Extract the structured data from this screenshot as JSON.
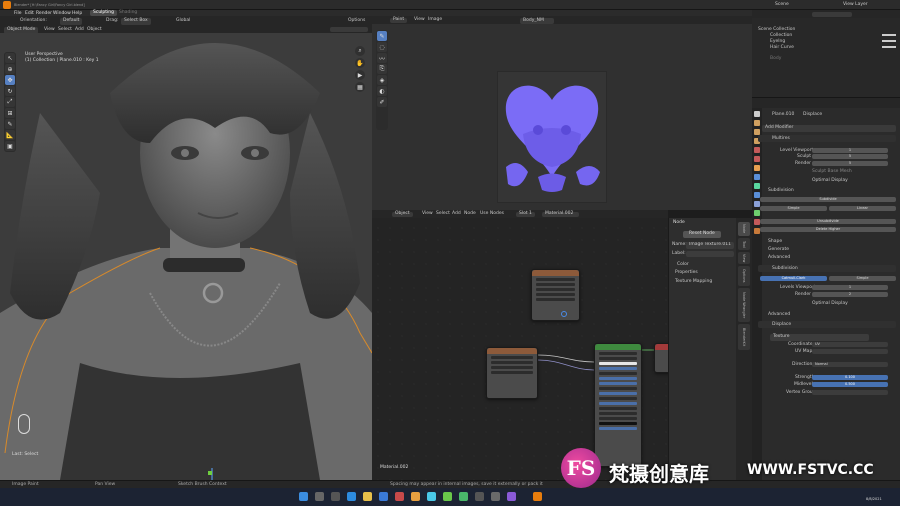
{
  "window": {
    "title": "Blender* [H:\\Fancy Girl\\Fancy Girl.blend]"
  },
  "menu": [
    "File",
    "Edit",
    "Render",
    "Window",
    "Help"
  ],
  "workspaces": [
    "Layout",
    "Modeling",
    "Sculpting",
    "UV Editing",
    "Texture Paint",
    "Shading"
  ],
  "active_workspace": "Sculpting",
  "top_right": {
    "scene": "Scene",
    "view_layer": "View Layer"
  },
  "viewport": {
    "orientation_label": "Orientation:",
    "orientation_value": "Default",
    "drag_label": "Drag:",
    "drag_value": "Select Box",
    "global_label": "Global",
    "options_label": "Options",
    "mode": "Object Mode",
    "menu": [
      "View",
      "Select",
      "Add",
      "Object"
    ],
    "overlay_title": "User Perspective",
    "overlay_sub": "(1) Collection | Plane.010 : Key 1",
    "status_left": "Last: Select"
  },
  "image_editor": {
    "menu": [
      "View",
      "Image"
    ],
    "mode": "Paint",
    "image_name": "Body_NM"
  },
  "node_editor": {
    "object_mode": "Object",
    "menu": [
      "View",
      "Select",
      "Add",
      "Node"
    ],
    "use_nodes": "Use Nodes",
    "slot": "Slot 1",
    "material": "Material.002",
    "footer_label": "Material.002",
    "tab_label": "Node",
    "reset_label": "Reset Node",
    "name_label": "Name:",
    "name_value": "Image Texture.011",
    "label_label": "Label:",
    "color_label": "Color",
    "properties_label": "Properties",
    "texture_mapping_label": "Texture Mapping",
    "side_tabs": [
      "Node",
      "Tool",
      "View",
      "Options",
      "Node Wrangler",
      "BlenderKit"
    ]
  },
  "outliner": {
    "title": "Scene Collection",
    "items": [
      "Collection",
      "Eyelng",
      "Hair Curve",
      "Body"
    ]
  },
  "properties": {
    "object_name": "Plane.010",
    "modifier_label": "Displace",
    "add_modifier": "Add Modifier",
    "multires": {
      "name": "Multires",
      "level_viewport_label": "Level Viewport",
      "level_viewport": "1",
      "sculpt_label": "Sculpt",
      "sculpt": "5",
      "render_label": "Render",
      "render": "5",
      "sculpt_base_mesh": "Sculpt Base Mesh",
      "optimal_display": "Optimal Display",
      "subdivision_label": "Subdivision",
      "subdivide": "Subdivide",
      "simple": "Simple",
      "linear": "Linear",
      "unsubdivide": "Unsubdivide",
      "delete_higher": "Delete Higher",
      "shape_label": "Shape",
      "generate_label": "Generate",
      "advanced_label": "Advanced"
    },
    "subdivision": {
      "name": "Subdivision",
      "catmull": "Catmull-Clark",
      "simple": "Simple",
      "levels_viewport_label": "Levels Viewport",
      "levels_viewport": "1",
      "render_label": "Render",
      "render": "2",
      "optimal_display": "Optimal Display",
      "advanced_label": "Advanced"
    },
    "displace": {
      "name": "Displace",
      "texture_label": "Texture",
      "coordinates_label": "Coordinates",
      "coordinates": "UV",
      "uv_map_label": "UV Map",
      "direction_label": "Direction",
      "direction": "Normal",
      "strength_label": "Strength",
      "strength": "0.100",
      "midlevel_label": "Midlevel",
      "midlevel": "0.500",
      "vertex_group_label": "Vertex Group"
    }
  },
  "statusbar": {
    "left": "Image Paint",
    "mid1": "Pan View",
    "mid2": "Sketch Brush Context",
    "message": "Spacing may appear in internal images, save it externally or pack it"
  },
  "taskbar": {
    "date": "8/8/2021"
  },
  "watermark": {
    "logo": "FS",
    "cn": "梵摄创意库",
    "url": "WWW.FSTVC.CC"
  },
  "colors": {
    "accent": "#4772b3",
    "uv_fill": "#7b6cf6",
    "orange": "#e87d0d",
    "selection": "#d88a2a"
  }
}
